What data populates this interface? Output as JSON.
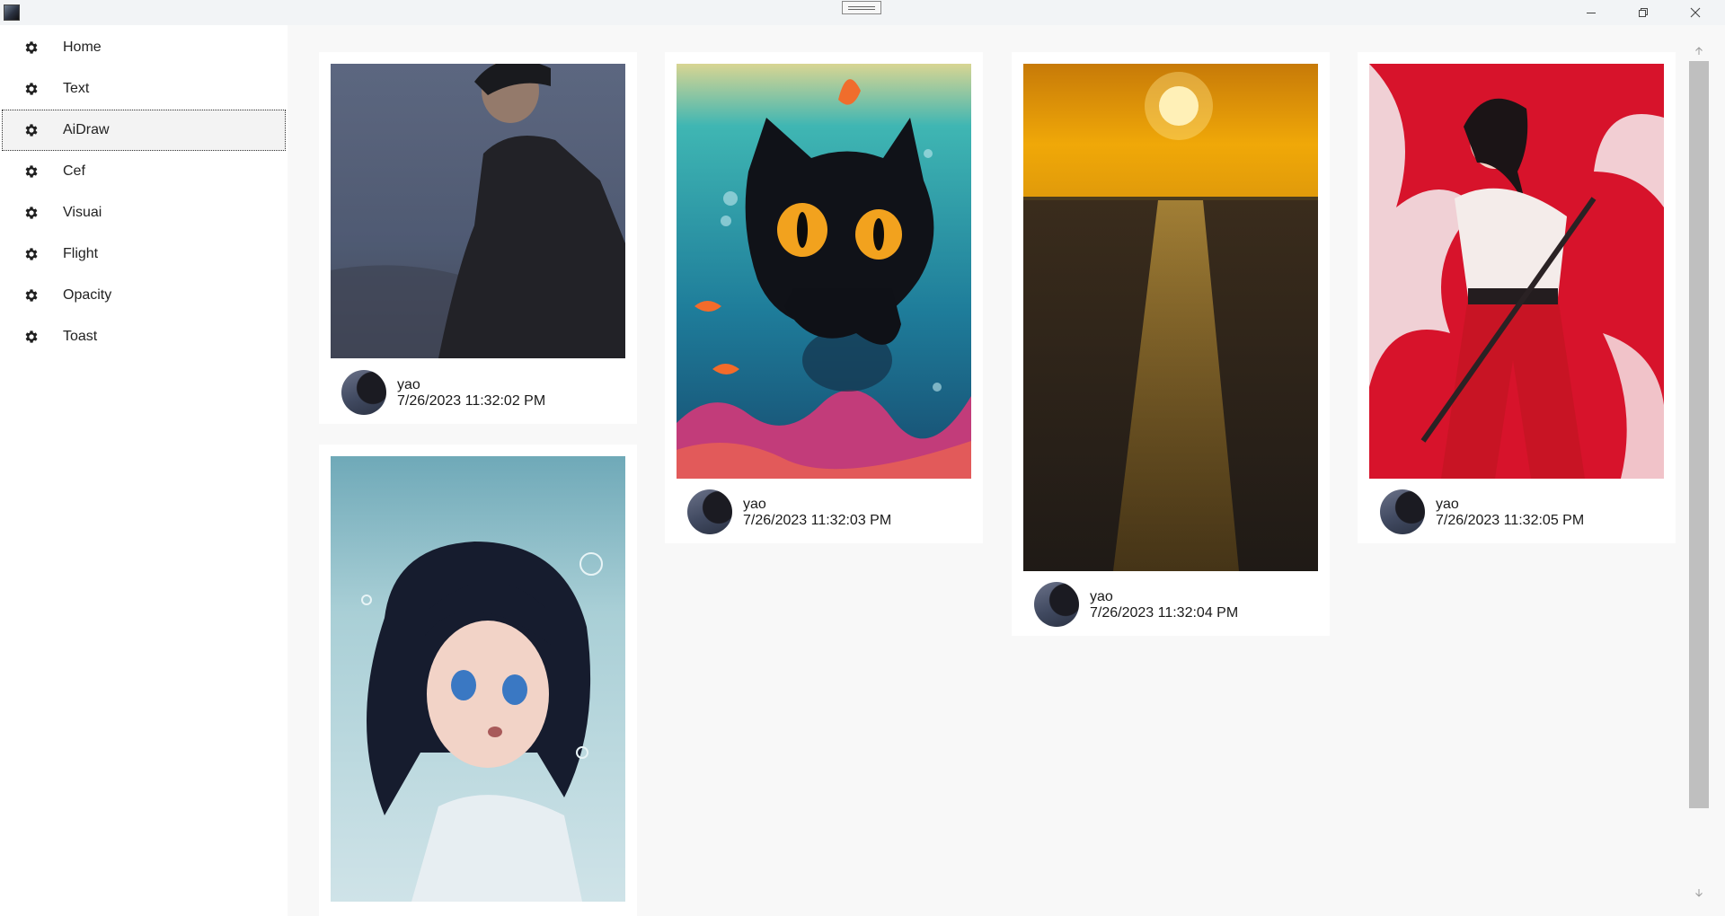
{
  "window": {
    "controls": {
      "minimize_icon": "minimize-icon",
      "restore_icon": "restore-icon",
      "close_icon": "close-icon"
    }
  },
  "sidebar": {
    "items": [
      {
        "label": "Home",
        "icon": "gear-icon"
      },
      {
        "label": "Text",
        "icon": "gear-icon"
      },
      {
        "label": "AiDraw",
        "icon": "gear-icon",
        "selected": true
      },
      {
        "label": "Cef",
        "icon": "gear-icon"
      },
      {
        "label": "Visuai",
        "icon": "gear-icon"
      },
      {
        "label": "Flight",
        "icon": "gear-icon"
      },
      {
        "label": "Opacity",
        "icon": "gear-icon"
      },
      {
        "label": "Toast",
        "icon": "gear-icon"
      }
    ]
  },
  "gallery": {
    "cards": [
      {
        "author": "yao",
        "date": "7/26/2023 11:32:02 PM",
        "image": "photo of person by the sea"
      },
      {
        "author": "yao",
        "date": "7/26/2023 11:32:03 PM",
        "image": "black cat underwater illustration"
      },
      {
        "author": "yao",
        "date": "7/26/2023 11:32:04 PM",
        "image": "sunset over sea"
      },
      {
        "author": "yao",
        "date": "7/26/2023 11:32:05 PM",
        "image": "anime swordswoman in red"
      },
      {
        "author": "",
        "date": "",
        "image": "anime girl underwater"
      }
    ]
  },
  "colors": {
    "accent_selected_bg": "#f3f3f3",
    "content_bg": "#f8f8f8",
    "card_bg": "#ffffff",
    "scroll_thumb": "#bfbfbf"
  }
}
